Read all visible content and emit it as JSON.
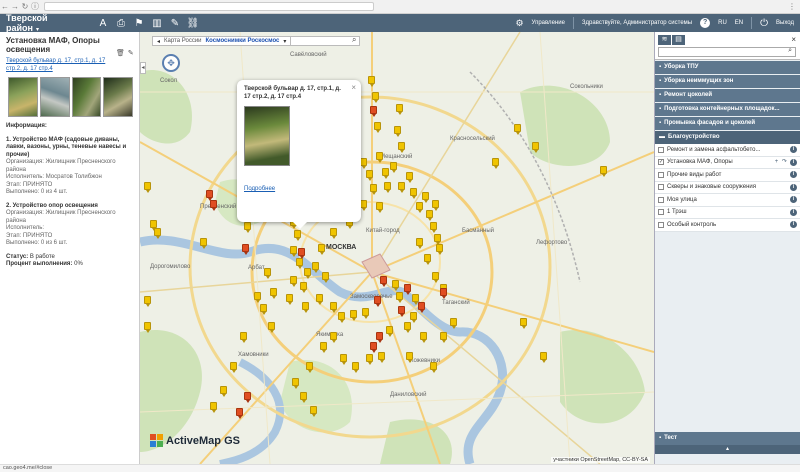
{
  "browser": {
    "url": "",
    "status_url": "cao.geo4.me/#close"
  },
  "header": {
    "title": "Тверской район",
    "manage_label": "Управление",
    "greeting": "Здравствуйте, Администратор системы",
    "help": "?",
    "lang_ru": "RU",
    "lang_en": "EN",
    "logout": "Выход"
  },
  "info_panel": {
    "title": "Установка МАФ, Опоры освещения",
    "address": "Тверской бульвар д. 17, стр.1, д. 17 стр.2, д. 17 стр.4",
    "info_heading": "Информация:",
    "task1_title": "1. Устройство МАФ (садовые диваны, лавки, вазоны, урны, теневые навесы и прочие)",
    "task1_org": "Организация: Жилищник Пресненского района",
    "task1_exec": "Исполнитель: Мосратов Толибжон",
    "task1_stage": "Этап: ПРИНЯТО",
    "task1_done": "Выполнено: 0 из 4 шт.",
    "task2_title": "2. Устройство опор освещения",
    "task2_org": "Организация: Жилищник Пресненского района",
    "task2_exec": "Исполнитель:",
    "task2_stage": "Этап: ПРИНЯТО",
    "task2_done": "Выполнено: 0 из 6 шт.",
    "status_label": "Статус:",
    "status_value": "В работе",
    "percent_label": "Процент выполнения:",
    "percent_value": "0%"
  },
  "map": {
    "tab1": "Карта России",
    "tab2": "Космоснимки Роскосмос",
    "labels": {
      "moscow": "МОСКВА",
      "presnensky": "Пресненский",
      "arbat": "Арбат",
      "kitay_gorod": "Китай-город",
      "zamoskvorechye": "Замоскворечье",
      "krasnoselsky": "Красносельский",
      "basmanny": "Басманный",
      "lefortovo": "Лефортово",
      "khamovniki": "Хамовники",
      "yakimanka": "Якиманка",
      "danilovsky": "Даниловский",
      "kozhevniki": "Кожевники",
      "tagansky": "Таганский",
      "savelovsky": "Савёловский",
      "sokolniki": "Сокольники",
      "dorogomilovo": "Дорогомилово",
      "meshchansky": "Мещанский",
      "sokol": "Сокол"
    },
    "popup": {
      "title": "Тверской бульвар д. 17, стр.1, д. 17 стр.2, д. 17 стр.4",
      "link": "Подробнее"
    },
    "logo": "ActiveMap GS",
    "credit": "участники OpenStreetMap, CC-BY-SA"
  },
  "layers": {
    "groups": [
      "Уборка ТПУ",
      "Уборка неиммущих зон",
      "Ремонт цоколей",
      "Подготовка контейнерных площадок...",
      "Промывка фасадов и цоколей"
    ],
    "open_group": "Благоустройство",
    "items": [
      {
        "label": "Ремонт и замена асфальтобето...",
        "checked": false
      },
      {
        "label": "Установка МАФ, Опоры",
        "checked": true
      },
      {
        "label": "Прочие виды работ",
        "checked": false
      },
      {
        "label": "Скверы и знаковые сооружения",
        "checked": false
      },
      {
        "label": "Моя улица",
        "checked": false
      },
      {
        "label": "1 Трэш",
        "checked": false
      },
      {
        "label": "Особый контроль",
        "checked": false
      }
    ],
    "footer_group": "Тест"
  },
  "colors": {
    "header": "#4d6479",
    "marker_yellow": "#f0c400",
    "marker_red": "#e04e22",
    "link": "#1a5fb4"
  }
}
